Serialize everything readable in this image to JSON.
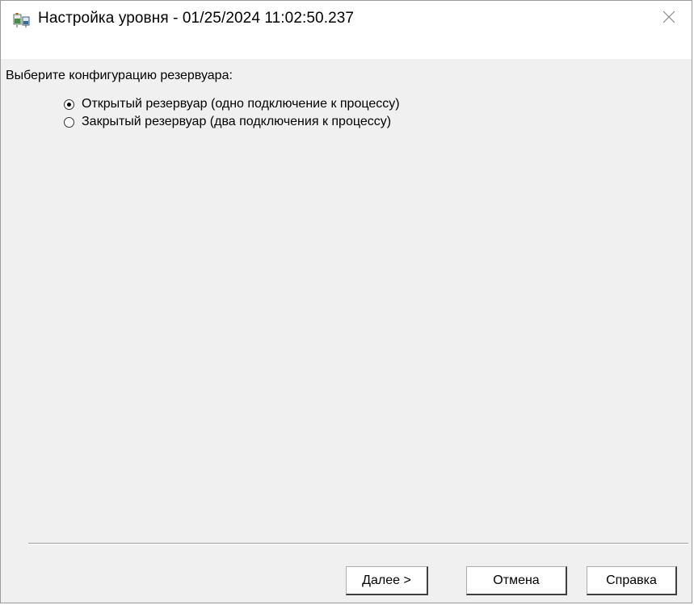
{
  "window": {
    "title": "Настройка уровня - 01/25/2024 11:02:50.237"
  },
  "content": {
    "prompt": "Выберите конфигурацию резервуара:",
    "options": [
      {
        "label": "Открытый резервуар (одно подключение к процессу)",
        "checked": true
      },
      {
        "label": "Закрытый резервуар (два подключения к процессу)",
        "checked": false
      }
    ]
  },
  "buttons": {
    "next": "Далее >",
    "cancel": "Отмена",
    "help": "Справка"
  },
  "icons": {
    "app": "level-setup-app-icon",
    "close": "close-icon"
  }
}
